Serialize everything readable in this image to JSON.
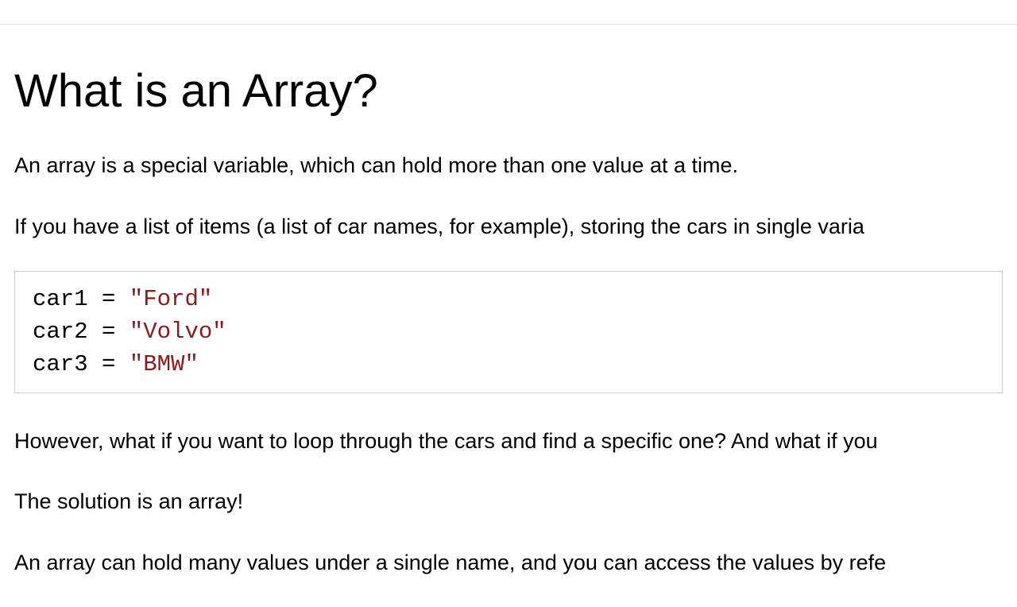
{
  "heading": "What is an Array?",
  "paragraphs": {
    "p1": "An array is a special variable, which can hold more than one value at a time.",
    "p2": "If you have a list of items (a list of car names, for example), storing the cars in single varia",
    "p3": "However, what if you want to loop through the cars and find a specific one? And what if you",
    "p4": "The solution is an array!",
    "p5": "An array can hold many values under a single name, and you can access the values by refe"
  },
  "code": {
    "line1_var": "car1 ",
    "line1_op": "= ",
    "line1_str": "\"Ford\"",
    "line2_var": "car2 ",
    "line2_op": "= ",
    "line2_str": "\"Volvo\"",
    "line3_var": "car3 ",
    "line3_op": "= ",
    "line3_str": "\"BMW\""
  }
}
